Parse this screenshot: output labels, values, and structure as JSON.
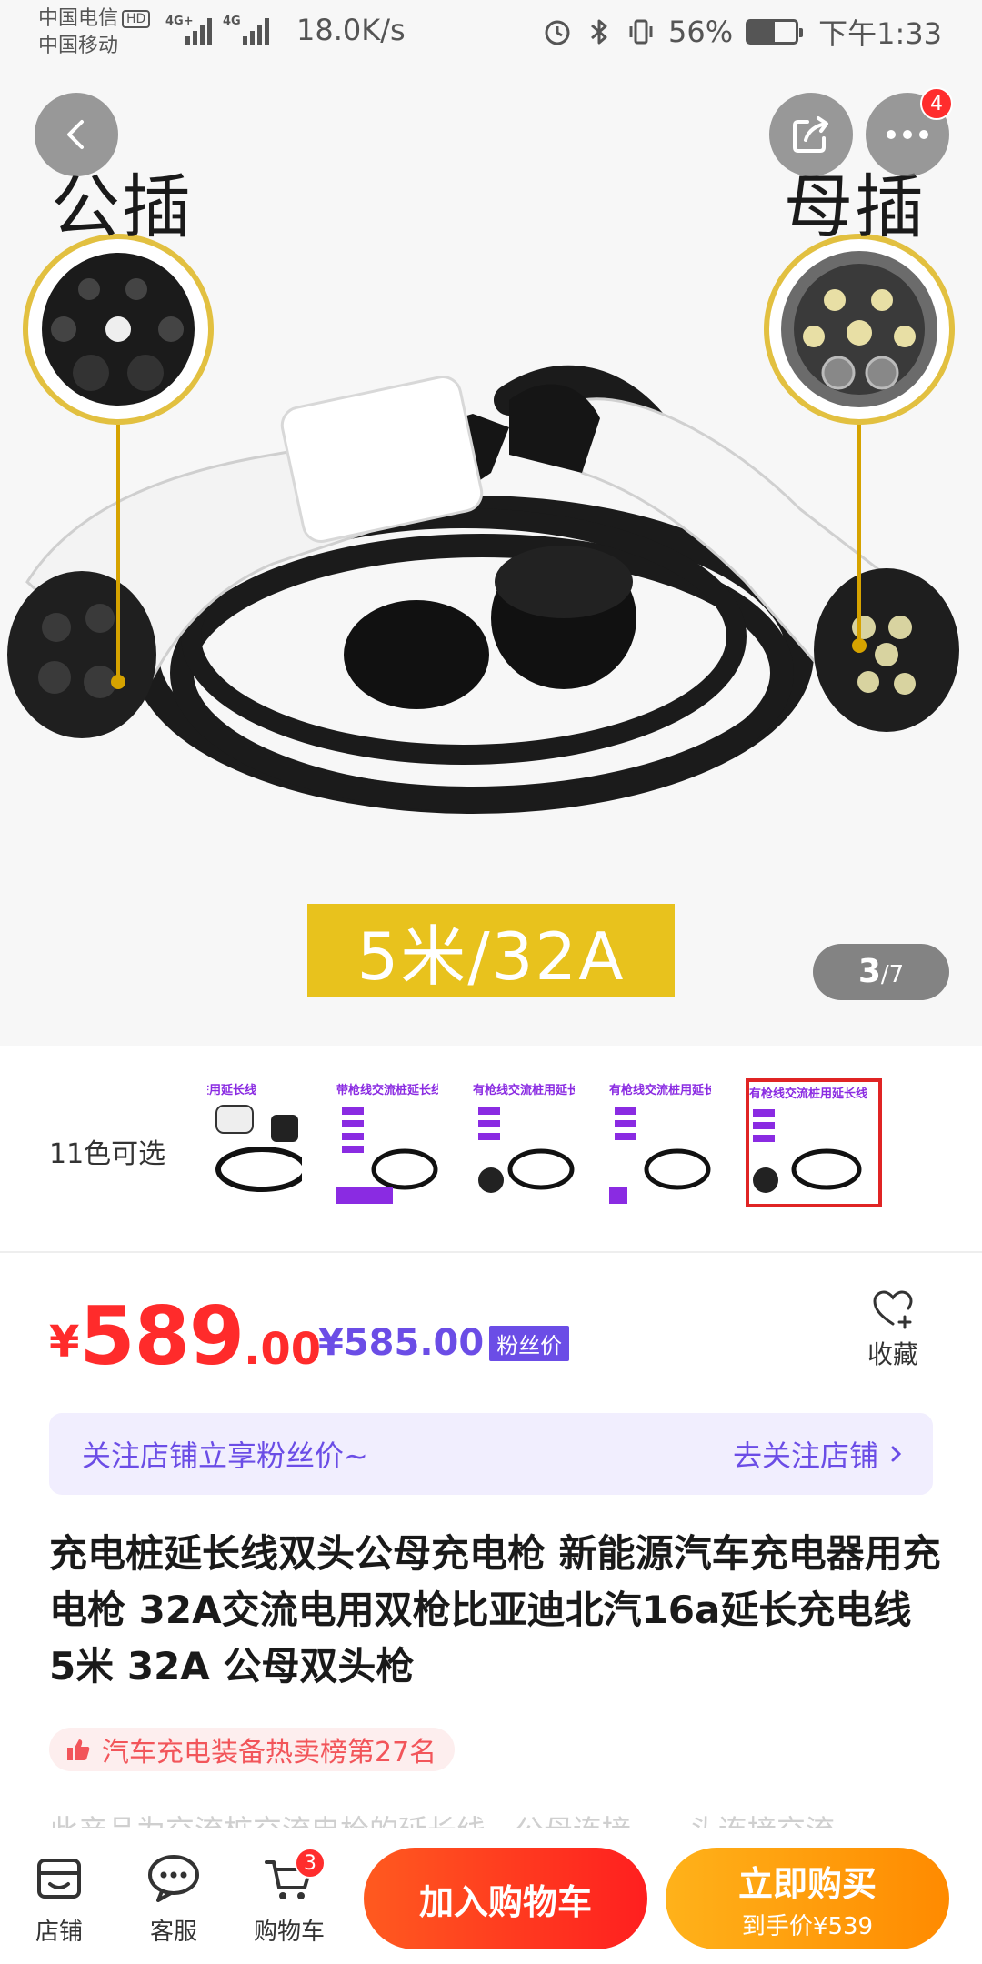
{
  "status_bar": {
    "carrier_1": "中国电信",
    "hd_badge": "HD",
    "carrier_2": "中国移动",
    "net_1": "4G+",
    "net_2": "4G",
    "speed": "18.0K/s",
    "battery": "56%",
    "battery_level": 0.56,
    "time": "下午1:33"
  },
  "hero": {
    "label_left": "公插",
    "label_right": "母插",
    "spec_badge": "5米/32A",
    "page_current": "3",
    "page_total": "/7",
    "more_badge": "4"
  },
  "variants": {
    "label": "11色可选",
    "thumbs": [
      {
        "caption": "延桩用延长线"
      },
      {
        "caption": "带枪线交流桩延长线"
      },
      {
        "caption": "有枪线交流桩用延长线"
      },
      {
        "caption": "有枪线交流桩用延长线"
      },
      {
        "caption": "有枪线交流桩用延长线"
      }
    ]
  },
  "price": {
    "currency": "¥",
    "integer": "589",
    "decimal": ".00",
    "fan_price": "¥585.00",
    "fan_tag": "粉丝价",
    "favorite_label": "收藏"
  },
  "follow_banner": {
    "text": "关注店铺立享粉丝价~",
    "action": "去关注店铺"
  },
  "title": "充电桩延长线双头公母充电枪 新能源汽车充电器用充电枪 32A交流电用双枪比亚迪北汽16a延长充电线 5米 32A 公母双头枪",
  "rank": "汽车充电装备热卖榜第27名",
  "description_partial": "此产品为交流桩交流电枪的延长线，公母连接，一头连接交流",
  "bottom_bar": {
    "store": "店铺",
    "service": "客服",
    "cart": "购物车",
    "cart_count": "3",
    "add_to_cart": "加入购物车",
    "buy_now": "立即购买",
    "buy_now_sub": "到手价¥539"
  },
  "colors": {
    "accent_red": "#ff2b2b",
    "fan_purple": "#6b4de6",
    "buy_orange": "#ff9a0f",
    "badge_yellow": "#e8c21d"
  }
}
